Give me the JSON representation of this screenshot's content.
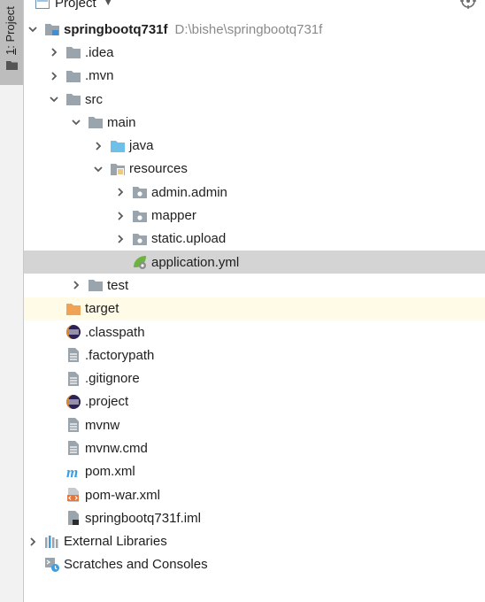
{
  "sidebar": {
    "tab_number": "1",
    "tab_label": ": Project"
  },
  "header": {
    "title": "Project"
  },
  "tree": {
    "root_name": "springbootq731f",
    "root_path": "D:\\bishe\\springbootq731f",
    "idea": ".idea",
    "mvn": ".mvn",
    "src": "src",
    "main": "main",
    "java": "java",
    "resources": "resources",
    "admin_admin": "admin.admin",
    "mapper": "mapper",
    "static_upload": "static.upload",
    "application_yml": "application.yml",
    "test": "test",
    "target": "target",
    "classpath": ".classpath",
    "factorypath": ".factorypath",
    "gitignore": ".gitignore",
    "project": ".project",
    "mvnw": "mvnw",
    "mvnw_cmd": "mvnw.cmd",
    "pom_xml": "pom.xml",
    "pom_war_xml": "pom-war.xml",
    "iml": "springbootq731f.iml",
    "external_libraries": "External Libraries",
    "scratches": "Scratches and Consoles"
  },
  "colors": {
    "folder": "#9aa4ad",
    "source_folder": "#6ec0e8",
    "excluded_folder": "#f0a255",
    "selection": "#d4d4d4",
    "excluded_row": "#fffbe6",
    "path_text": "#8a8a8a"
  },
  "icons": {
    "folder": "folder-icon",
    "source_folder": "source-folder-icon",
    "resources_folder": "resources-folder-icon",
    "package": "package-icon",
    "spring_config": "spring-config-icon",
    "eclipse": "eclipse-icon",
    "text_file": "text-file-icon",
    "maven": "maven-icon",
    "xml": "xml-file-icon",
    "iml": "iml-file-icon",
    "libraries": "libraries-icon",
    "scratches": "scratches-icon"
  }
}
